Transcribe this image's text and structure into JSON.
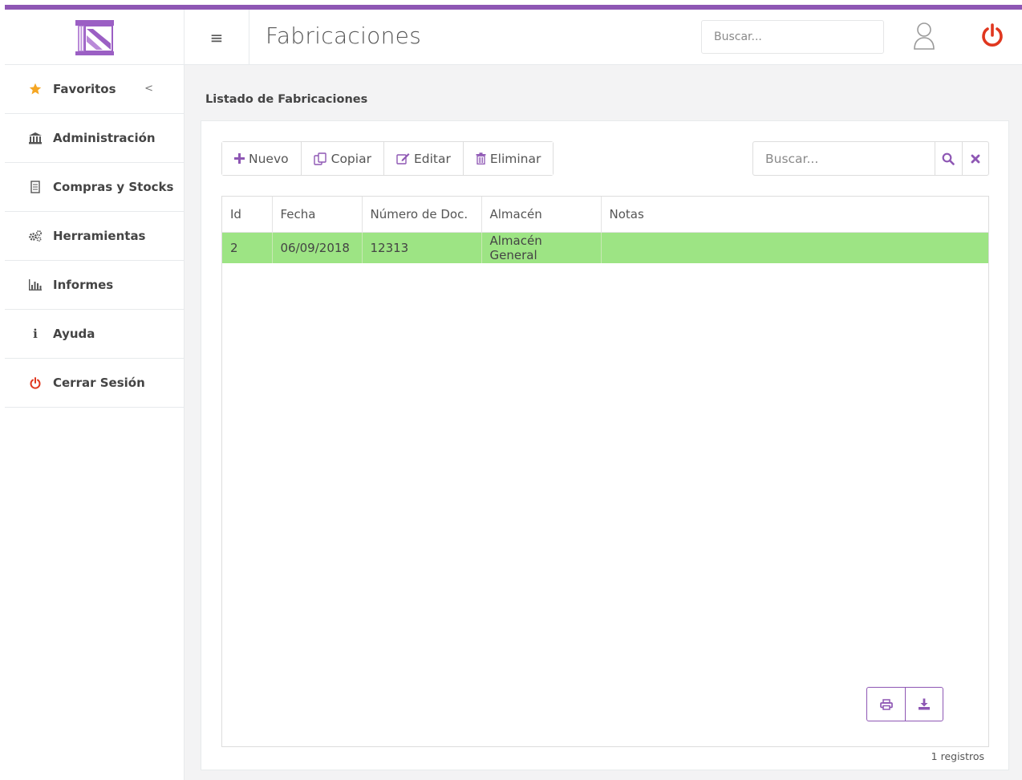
{
  "app": {
    "accent_color": "#8e57b4",
    "logo_icon": "building-columns-logo"
  },
  "header": {
    "menu_icon": "hamburger-icon",
    "title": "Fabricaciones",
    "search_placeholder": "Buscar...",
    "user_icon": "user-icon",
    "power_icon": "power-icon",
    "power_color": "#e0371f"
  },
  "sidebar": {
    "items": [
      {
        "label": "Favoritos",
        "icon": "star-icon",
        "chevron": "<"
      },
      {
        "label": "Administración",
        "icon": "bank-icon"
      },
      {
        "label": "Compras y Stocks",
        "icon": "document-icon"
      },
      {
        "label": "Herramientas",
        "icon": "gears-icon"
      },
      {
        "label": "Informes",
        "icon": "bar-chart-icon"
      },
      {
        "label": "Ayuda",
        "icon": "info-icon"
      },
      {
        "label": "Cerrar Sesión",
        "icon": "power-icon"
      }
    ]
  },
  "main": {
    "breadcrumb": "Listado de Fabricaciones",
    "toolbar": {
      "nuevo": "Nuevo",
      "copiar": "Copiar",
      "editar": "Editar",
      "eliminar": "Eliminar"
    },
    "search_placeholder": "Buscar...",
    "table": {
      "columns": [
        "Id",
        "Fecha",
        "Número de Doc.",
        "Almacén",
        "Notas"
      ],
      "rows": [
        [
          "2",
          "06/09/2018",
          "12313",
          "Almacén General",
          ""
        ]
      ],
      "selected_row_color": "#9de484"
    },
    "records_label": "1 registros"
  }
}
